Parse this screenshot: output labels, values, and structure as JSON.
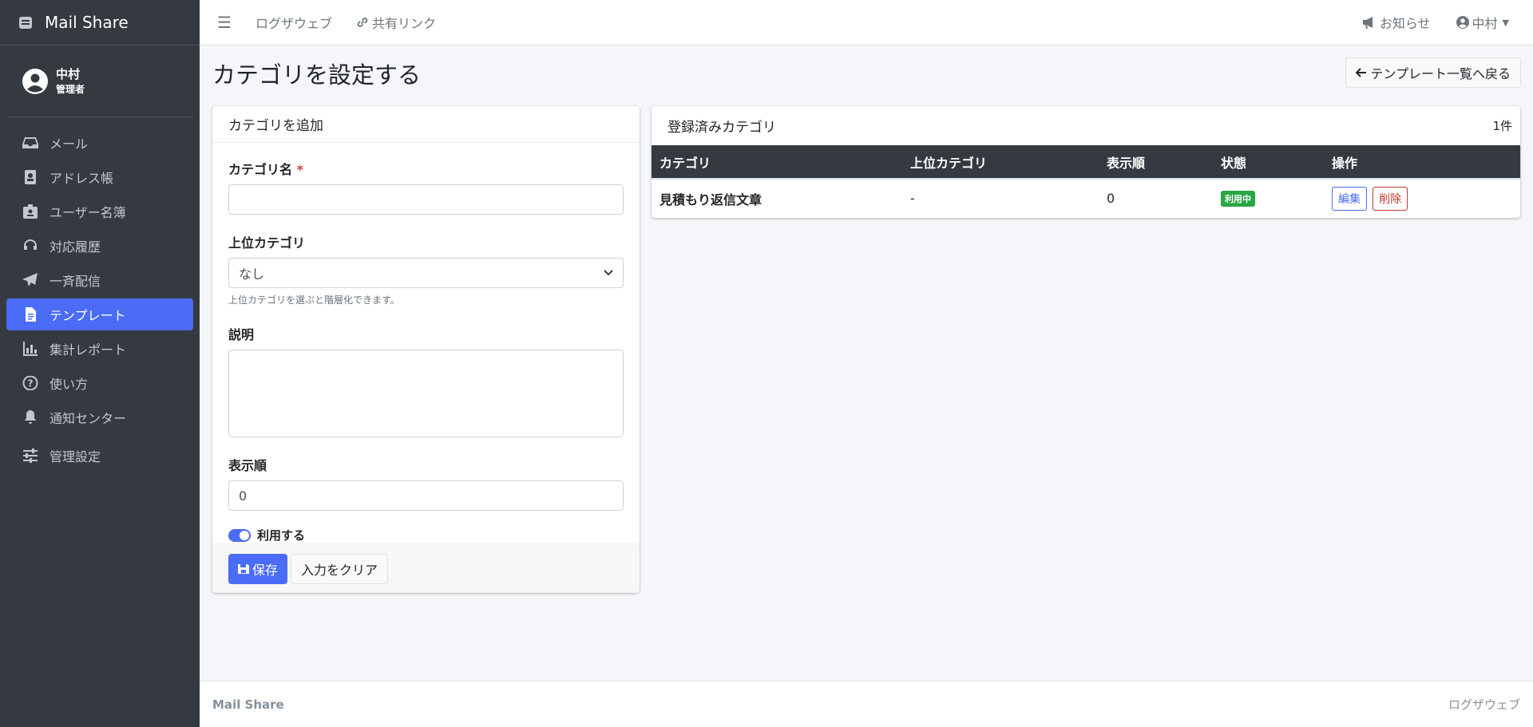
{
  "app": {
    "brand": "Mail Share"
  },
  "user": {
    "name": "中村",
    "role": "管理者"
  },
  "sidebar": {
    "items": [
      {
        "label": "メール"
      },
      {
        "label": "アドレス帳"
      },
      {
        "label": "ユーザー名簿"
      },
      {
        "label": "対応履歴"
      },
      {
        "label": "一斉配信"
      },
      {
        "label": "テンプレート"
      },
      {
        "label": "集計レポート"
      },
      {
        "label": "使い方"
      },
      {
        "label": "通知センター"
      },
      {
        "label": "管理設定"
      }
    ]
  },
  "topbar": {
    "links": [
      "ログザウェブ",
      "共有リンク"
    ],
    "notice": "お知らせ",
    "user": "中村"
  },
  "page": {
    "title": "カテゴリを設定する",
    "back_label": "テンプレート一覧へ戻る"
  },
  "form": {
    "header": "カテゴリを追加",
    "name_label": "カテゴリ名",
    "required_mark": "*",
    "name_value": "",
    "parent_label": "上位カテゴリ",
    "parent_selected": "なし",
    "parent_hint": "上位カテゴリを選ぶと階層化できます。",
    "desc_label": "説明",
    "desc_value": "",
    "order_label": "表示順",
    "order_value": "0",
    "enabled_label": "利用する",
    "enabled": true,
    "save_label": "保存",
    "clear_label": "入力をクリア"
  },
  "list": {
    "header": "登録済みカテゴリ",
    "count": "1件",
    "columns": [
      "カテゴリ",
      "上位カテゴリ",
      "表示順",
      "状態",
      "操作"
    ],
    "rows": [
      {
        "name": "見積もり返信文章",
        "parent": "-",
        "order": "0",
        "status": "利用中",
        "edit": "編集",
        "delete": "削除"
      }
    ]
  },
  "footer": {
    "left": "Mail Share",
    "right": "ログザウェブ"
  },
  "colors": {
    "sidebar": "#343a40",
    "accent": "#4a6cf7",
    "success": "#28a745",
    "danger": "#c0392b"
  }
}
